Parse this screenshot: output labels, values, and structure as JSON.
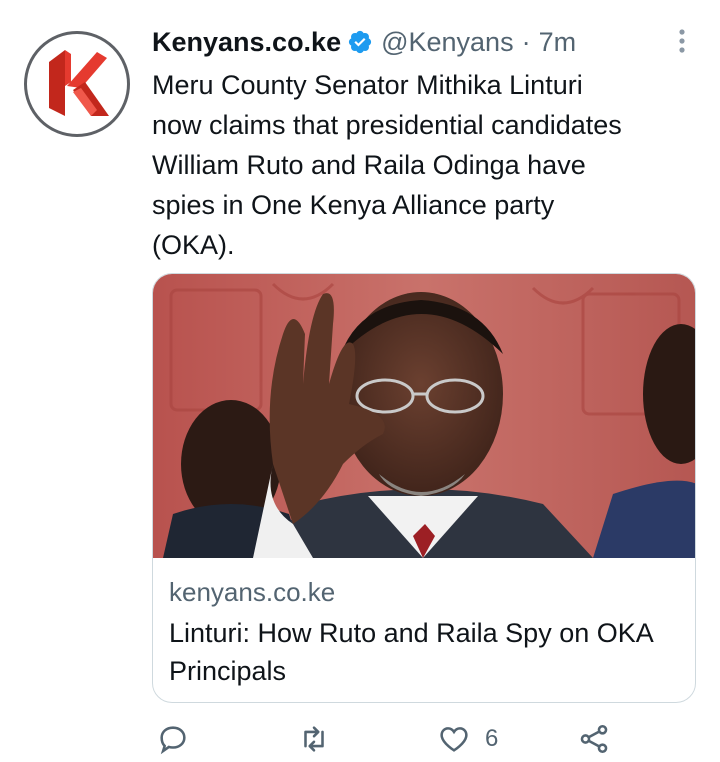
{
  "tweet": {
    "display_name": "Kenyans.co.ke",
    "handle": "@Kenyans",
    "separator": "·",
    "time": "7m",
    "text": "Meru County Senator Mithika Linturi\nnow claims that presidential candidates\nWilliam Ruto and Raila Odinga have\nspies in One Kenya Alliance party\n(OKA).",
    "avatar_icon": "kenyans-k-logo-icon"
  },
  "card": {
    "domain": "kenyans.co.ke",
    "title": "Linturi: How Ruto and Raila Spy on OKA Principals"
  },
  "actions": {
    "reply_icon": "reply-icon",
    "retweet_icon": "retweet-icon",
    "like_icon": "heart-icon",
    "like_count": "6",
    "share_icon": "share-icon"
  },
  "colors": {
    "text": "#0f1419",
    "secondary": "#536471",
    "verified": "#1d9bf0",
    "logo_red": "#e53a2f"
  }
}
